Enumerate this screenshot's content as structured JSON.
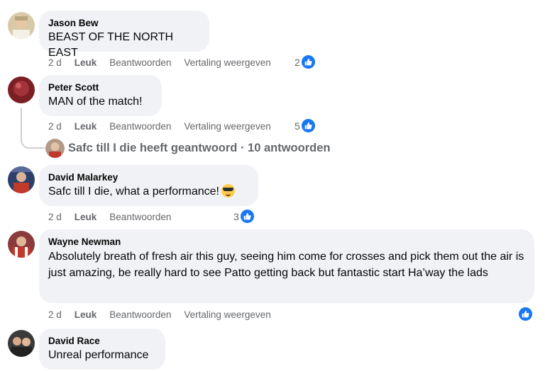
{
  "comments": [
    {
      "author": "Jason Bew",
      "text": "BEAST OF THE NORTH EAST",
      "time": "2 d",
      "like": "Leuk",
      "reply": "Beantwoorden",
      "translate": "Vertaling weergeven",
      "reactions": "2"
    },
    {
      "author": "Peter Scott",
      "text": "MAN of the match!",
      "time": "2 d",
      "like": "Leuk",
      "reply": "Beantwoorden",
      "translate": "Vertaling weergeven",
      "reactions": "5",
      "replies_summary": "Safc till I die heeft geantwoord · 10 antwoorden"
    },
    {
      "author": "David Malarkey",
      "text": "Safc till I die, what a performance!",
      "emoji": "smiling-face-with-sunglasses",
      "time": "2 d",
      "like": "Leuk",
      "reply": "Beantwoorden",
      "reactions": "3"
    },
    {
      "author": "Wayne Newman",
      "text": "Absolutely breath of fresh air this guy, seeing him come for crosses and pick them out the air is just amazing, be really hard to see Patto getting back but fantastic start Ha’way the lads",
      "time": "2 d",
      "like": "Leuk",
      "reply": "Beantwoorden",
      "translate": "Vertaling weergeven",
      "reactions": ""
    },
    {
      "author": "David Race",
      "text": "Unreal performance"
    }
  ],
  "colors": {
    "bubble": "#f0f2f5",
    "meta": "#65676b",
    "like_blue": "#1877f2"
  }
}
